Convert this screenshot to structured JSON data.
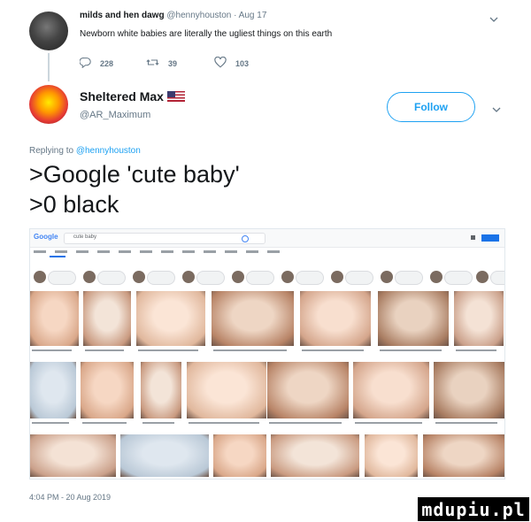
{
  "original_tweet": {
    "display_name": "milds and hen dawg",
    "handle": "@hennyhouston",
    "date": "· Aug 17",
    "text": "Newborn white babies are literally the ugliest things on this earth",
    "replies": "228",
    "retweets": "39",
    "likes": "103",
    "icons": [
      "reply-icon",
      "retweet-icon",
      "like-icon",
      "chevron-down-icon"
    ]
  },
  "reply": {
    "display_name": "Sheltered Max",
    "flag": "🇺🇸",
    "handle": "@AR_Maximum",
    "follow_label": "Follow",
    "replying_to_prefix": "Replying to",
    "replying_to_handle": "@hennyhouston",
    "line1": ">Google 'cute baby'",
    "line2": ">0 black",
    "timestamp": "4:04 PM - 20 Aug 2019"
  },
  "google_screenshot": {
    "logo": "Google",
    "query": "cute baby"
  },
  "watermark": "mdupiu.pl",
  "colors": {
    "link": "#1da1f2",
    "muted": "#657786",
    "text": "#14171a"
  }
}
